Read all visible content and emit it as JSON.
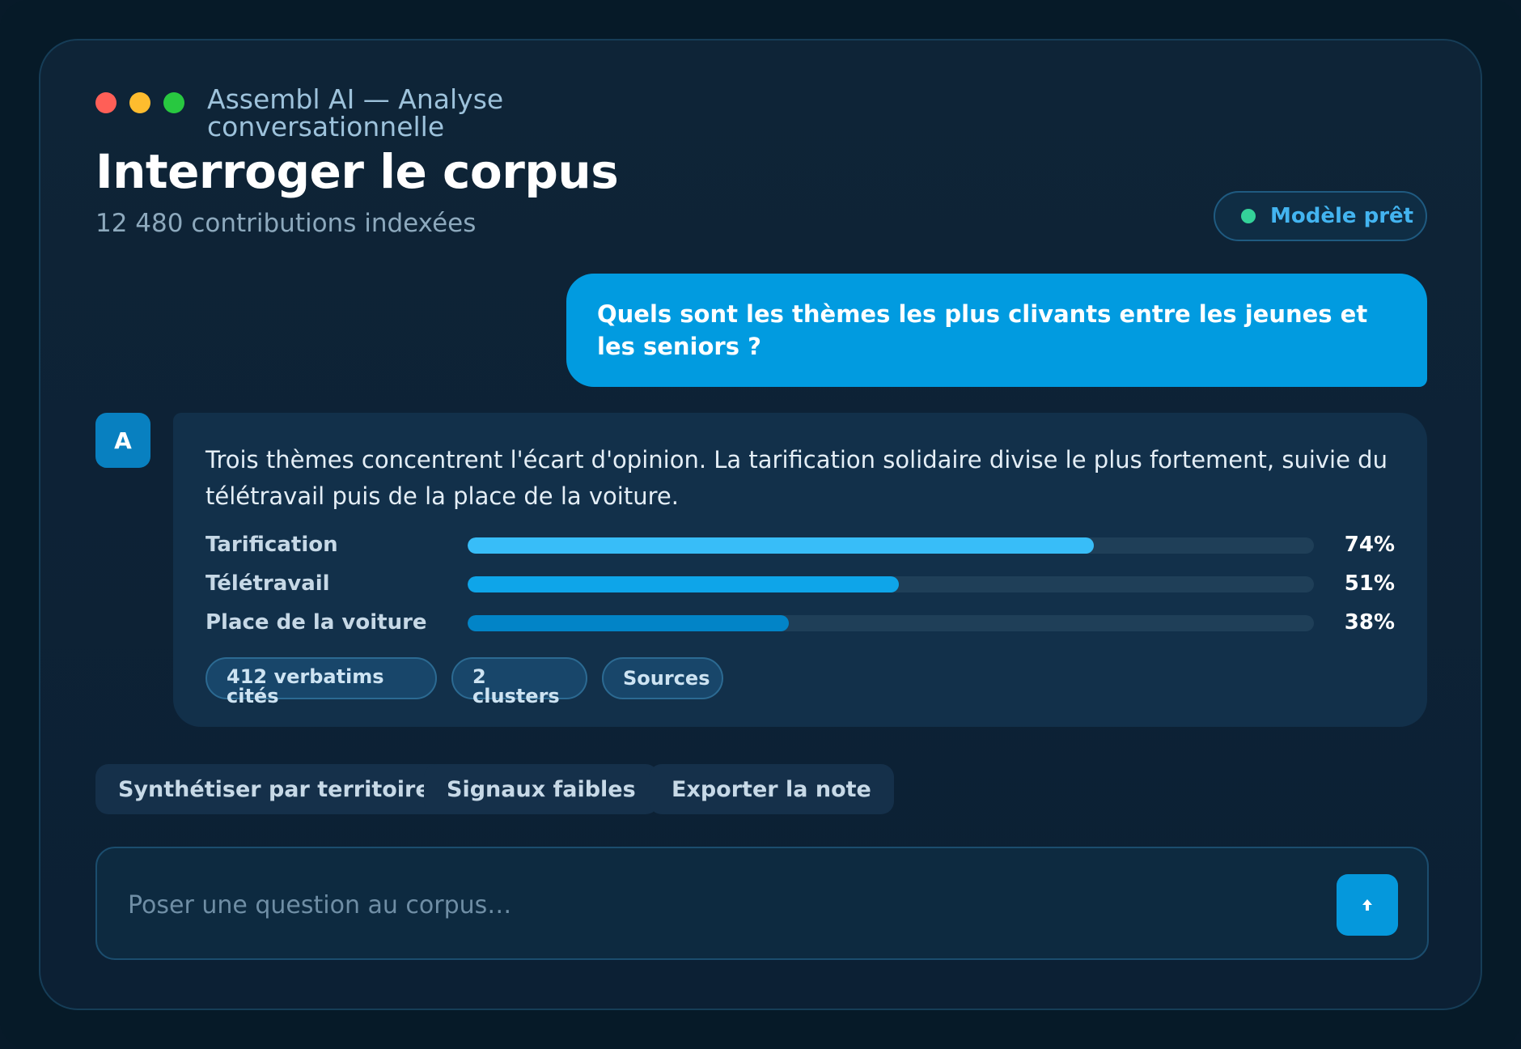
{
  "window": {
    "title": "Assembl AI — Analyse conversationnelle",
    "controls": {
      "close_color": "#ff5f57",
      "minimize_color": "#febc2e",
      "maximize_color": "#28c840"
    }
  },
  "header": {
    "title": "Interroger le corpus",
    "subtitle": "12 480 contributions indexées",
    "status_label": "Modèle prêt",
    "status_color": "#34d399"
  },
  "conversation": {
    "user_message": "Quels sont les thèmes les plus clivants entre les jeunes et les seniors ?",
    "assistant_avatar": "A",
    "assistant_message": "Trois thèmes concentrent l'écart d'opinion. La tarification solidaire divise le plus fortement, suivie du télétravail puis de la place de la voiture.",
    "themes": [
      {
        "label": "Tarification",
        "value": 0.74,
        "value_text": "74%",
        "color": "#38bdf8"
      },
      {
        "label": "Télétravail",
        "value": 0.51,
        "value_text": "51%",
        "color": "#0ea5e9"
      },
      {
        "label": "Place de la voiture",
        "value": 0.38,
        "value_text": "38%",
        "color": "#0284c7"
      }
    ],
    "chips": [
      "412 verbatims cités",
      "2 clusters",
      "Sources"
    ]
  },
  "suggestions": [
    "Synthétiser par territoire",
    "Signaux faibles",
    "Exporter la note"
  ],
  "composer": {
    "placeholder": "Poser une question au corpus…",
    "send_icon": "arrow-up-icon"
  },
  "colors": {
    "accent": "#019be0",
    "background": "#0c2034"
  }
}
